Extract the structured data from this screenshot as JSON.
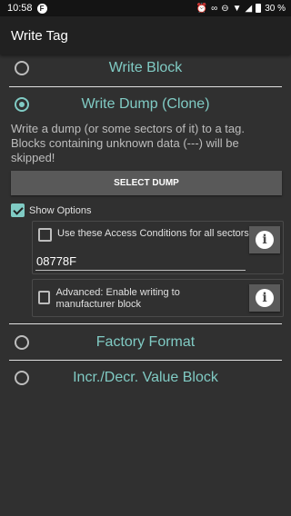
{
  "status_bar": {
    "time": "10:58",
    "app_icon_letter": "F",
    "battery_text": "30 %"
  },
  "toolbar": {
    "title": "Write Tag"
  },
  "options": {
    "write_block": "Write Block",
    "write_dump": "Write Dump (Clone)",
    "factory_format": "Factory Format",
    "value_block": "Incr./Decr. Value Block"
  },
  "write_dump": {
    "description": "Write a dump (or some sectors of it) to a tag. Blocks containing unknown data (---) will be skipped!",
    "select_dump_label": "SELECT DUMP",
    "show_options_label": "Show Options",
    "access_conditions_label": "Use these Access Conditions for all sectors:",
    "access_conditions_value": "08778F",
    "advanced_label": "Advanced: Enable writing to manufacturer block"
  },
  "colors": {
    "accent": "#80cbc4",
    "background": "#303030",
    "toolbar": "#212121"
  }
}
